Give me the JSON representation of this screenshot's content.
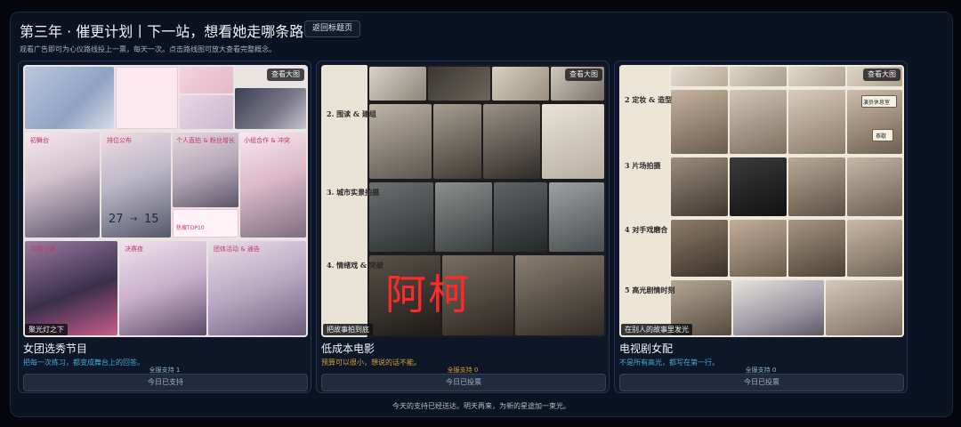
{
  "header": {
    "title": "第三年 · 催更计划丨下一站，想看她走哪条路？",
    "back_button": "返回标题页",
    "subtitle": "观看广告即可为心仪路线投上一票，每天一次。点击路线图可放大查看完整概念。"
  },
  "cards": [
    {
      "view_label": "查看大图",
      "corner_label": "聚光灯之下",
      "title": "女团选秀节目",
      "description": "把每一次练习，都变成舞台上的回答。",
      "support": "全服支持 1",
      "button": "今日已支持",
      "accent": "#44a9d6",
      "image_text": {
        "sections": [
          "初舞台",
          "排位公布",
          "个人直拍 & 粉丝增长",
          "小组合作 & 冲突",
          "中期公演",
          "决赛夜",
          "团体活动 & 通告"
        ],
        "rank_from": "27",
        "rank_to": "15",
        "badge": "热搜TOP10"
      }
    },
    {
      "view_label": "查看大图",
      "corner_label": "把故事拍到底",
      "watermark": "阿柯",
      "title": "低成本电影",
      "description": "预算可以很小，想说的话不能。",
      "support": "全服支持 0",
      "button": "今日已投票",
      "accent": "#d7a13a",
      "image_text": {
        "sections": [
          "2. 围读 & 建组",
          "3. 城市实景拍摄",
          "4. 情绪戏 & 突破"
        ]
      }
    },
    {
      "view_label": "查看大图",
      "corner_label": "在别人的故事里发光",
      "title": "电视剧女配",
      "description": "不是所有高光，都写在第一行。",
      "support": "全服支持 0",
      "button": "今日已投票",
      "accent": "#44a9d6",
      "image_text": {
        "sections": [
          "2 定妆 & 造型",
          "3 片场拍摄",
          "4 对手戏磨合",
          "5 高光剧情时刻"
        ],
        "signs": [
          "演员休息室",
          "茶歇"
        ]
      }
    }
  ],
  "footer": "今天的支持已经送达。明天再来，为新的星途加一束光。"
}
